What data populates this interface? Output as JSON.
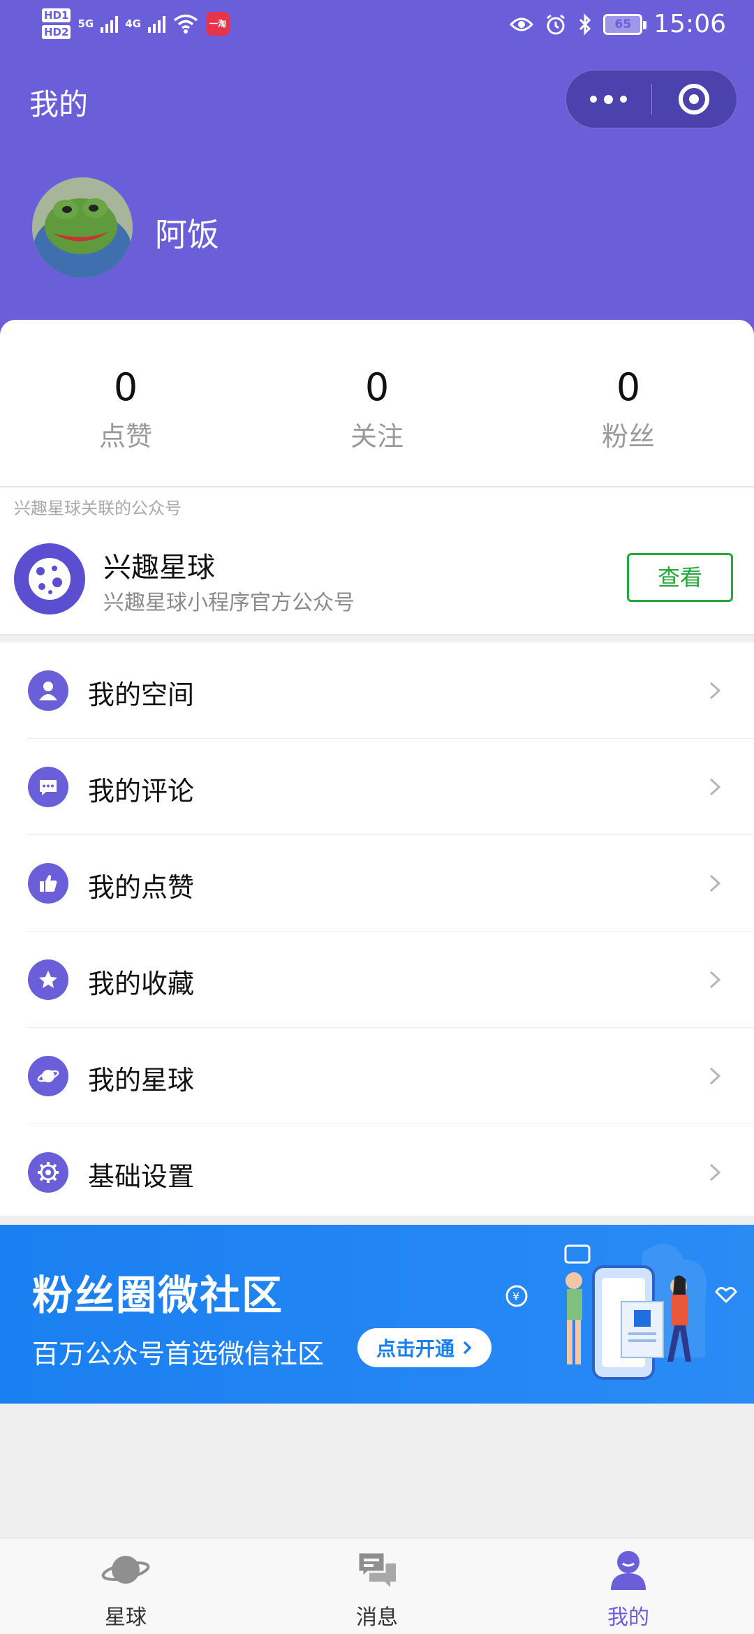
{
  "status_bar": {
    "hd1": "HD1",
    "hd2": "HD2",
    "net1": "5G",
    "net2": "4G",
    "app_badge": "一淘",
    "battery": "65",
    "time": "15:06"
  },
  "nav": {
    "title": "我的"
  },
  "profile": {
    "name": "阿饭"
  },
  "stats": [
    {
      "value": "0",
      "label": "点赞"
    },
    {
      "value": "0",
      "label": "关注"
    },
    {
      "value": "0",
      "label": "粉丝"
    }
  ],
  "official_account": {
    "caption": "兴趣星球关联的公众号",
    "name": "兴趣星球",
    "description": "兴趣星球小程序官方公众号",
    "button_label": "查看"
  },
  "menu": [
    {
      "label": "我的空间",
      "icon": "user-icon"
    },
    {
      "label": "我的评论",
      "icon": "comment-icon"
    },
    {
      "label": "我的点赞",
      "icon": "thumbs-up-icon"
    },
    {
      "label": "我的收藏",
      "icon": "star-icon"
    },
    {
      "label": "我的星球",
      "icon": "planet-icon"
    },
    {
      "label": "基础设置",
      "icon": "gear-icon"
    }
  ],
  "banner": {
    "title": "粉丝圈微社区",
    "subtitle": "百万公众号首选微信社区",
    "button_label": "点击开通"
  },
  "tabbar": [
    {
      "label": "星球",
      "icon": "planet-icon",
      "active": false
    },
    {
      "label": "消息",
      "icon": "chat-icon",
      "active": false
    },
    {
      "label": "我的",
      "icon": "person-icon",
      "active": true
    }
  ],
  "colors": {
    "accent": "#6b5fd9",
    "button_green": "#23a83a",
    "banner_blue": "#1a7ff0"
  }
}
